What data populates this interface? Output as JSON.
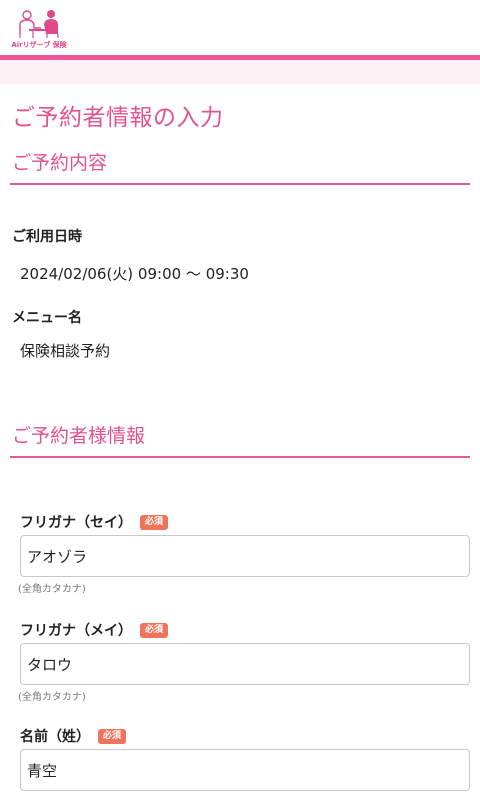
{
  "header": {
    "logo_text": "Airリザーブ 保険",
    "colors": {
      "brand": "#f0569a",
      "band": "#fdf1f6"
    }
  },
  "page": {
    "title": "ご予約者情報の入力"
  },
  "reservation_section": {
    "heading": "ご予約内容",
    "datetime_label": "ご利用日時",
    "datetime_value": "2024/02/06(火) 09:00 〜 09:30",
    "menu_label": "メニュー名",
    "menu_value": "保険相談予約"
  },
  "customer_section": {
    "heading": "ご予約者様情報",
    "required_label": "必須",
    "fields": [
      {
        "label": "フリガナ（セイ）",
        "value": "アオゾラ",
        "hint": "(全角カタカナ)"
      },
      {
        "label": "フリガナ（メイ）",
        "value": "タロウ",
        "hint": "(全角カタカナ)"
      },
      {
        "label": "名前（姓）",
        "value": "青空"
      }
    ]
  },
  "icons": {
    "logo": "people-consulting-logo-icon"
  }
}
